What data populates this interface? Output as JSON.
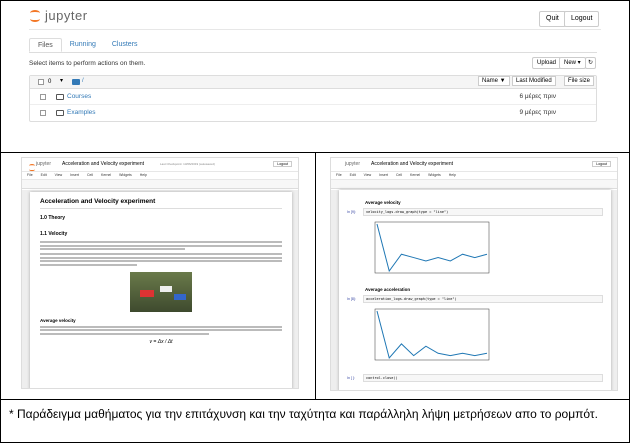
{
  "home": {
    "logo_text": "jupyter",
    "quit": "Quit",
    "logout": "Logout",
    "tabs": [
      "Files",
      "Running",
      "Clusters"
    ],
    "select_text": "Select items to perform actions on them.",
    "upload": "Upload",
    "new": "New ▾",
    "refresh_icon": "↻",
    "count": "0",
    "breadcrumb": "/",
    "col_name": "Name ▼",
    "col_modified": "Last Modified",
    "col_size": "File size",
    "rows": [
      {
        "name": "Courses",
        "time": "6 μέρες πριν"
      },
      {
        "name": "Examples",
        "time": "9 μέρες πριν"
      }
    ]
  },
  "nb_left": {
    "title": "Acceleration and Velocity experiment",
    "checkpoint": "Last Checkpoint: 13/06/2019 (autosaved)",
    "logout": "Logout",
    "menu": [
      "File",
      "Edit",
      "View",
      "Insert",
      "Cell",
      "Kernel",
      "Widgets",
      "Help"
    ],
    "h1": "Acceleration and Velocity experiment",
    "h2": "1.0 Theory",
    "h3": "1.1 Velocity",
    "h4": "Average velocity",
    "formula": "v = Δx / Δt"
  },
  "nb_right": {
    "title": "Acceleration and Velocity experiment",
    "h_vel": "Average velocity",
    "code1": "velocity_logs.draw_graph(type = \"line\")",
    "h_acc": "Average acceleration",
    "code2": "acceleration_logs.draw_graph(type = \"line\")",
    "code3": "control.close()",
    "prompt1": "In [9]:",
    "prompt2": "In [8]:",
    "prompt3": "In [ ]:"
  },
  "caption": "* Παράδειγμα μαθήματος για την επιτάχυνση και την ταχύτητα και παράλληλη λήψη μετρήσεων απο το ρομπότ.",
  "chart_velocity": [
    0.14,
    0.07,
    0.095,
    0.09,
    0.085,
    0.09,
    0.085,
    0.095,
    0.09,
    0.095
  ],
  "chart_accel": [
    0.25,
    0.05,
    0.11,
    0.06,
    0.1,
    0.07,
    0.06,
    0.07,
    0.06,
    0.07
  ],
  "colors": {
    "accent": "#f37726",
    "link": "#337ab7",
    "line": "#1f77b4"
  }
}
